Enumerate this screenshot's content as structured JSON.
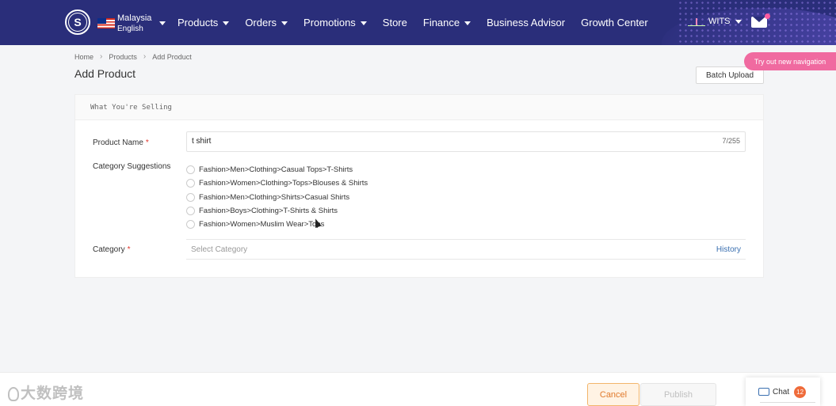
{
  "nav": {
    "logo": "S",
    "region": "Malaysia",
    "language": "English",
    "items": [
      "Products",
      "Orders",
      "Promotions",
      "Store",
      "Finance",
      "Business Advisor",
      "Growth Center"
    ],
    "user": "WITS"
  },
  "breadcrumb": [
    "Home",
    "Products",
    "Add Product"
  ],
  "page_title": "Add Product",
  "batch_upload": "Batch Upload",
  "try_out": "Try out new navigation",
  "section_title": "What You're Selling",
  "form": {
    "product_name_label": "Product Name",
    "product_name_value": "t shirt",
    "product_name_count": "7/255",
    "suggestions_label": "Category Suggestions",
    "suggestions": [
      "Fashion>Men>Clothing>Casual Tops>T-Shirts",
      "Fashion>Women>Clothing>Tops>Blouses & Shirts",
      "Fashion>Men>Clothing>Shirts>Casual Shirts",
      "Fashion>Boys>Clothing>T-Shirts & Shirts",
      "Fashion>Women>Muslim Wear>Tops"
    ],
    "category_label": "Category",
    "category_placeholder": "Select Category",
    "history": "History",
    "required_mark": "*"
  },
  "footer": {
    "watermark": "大数跨境",
    "cancel": "Cancel",
    "publish": "Publish",
    "chat": "Chat",
    "chat_badge": "12"
  },
  "colors": {
    "nav_bg": "#2a2e7a",
    "accent_orange": "#e07a2c",
    "pink": "#f06aa0",
    "link_blue": "#3a6fb0",
    "required": "#e0352b"
  }
}
